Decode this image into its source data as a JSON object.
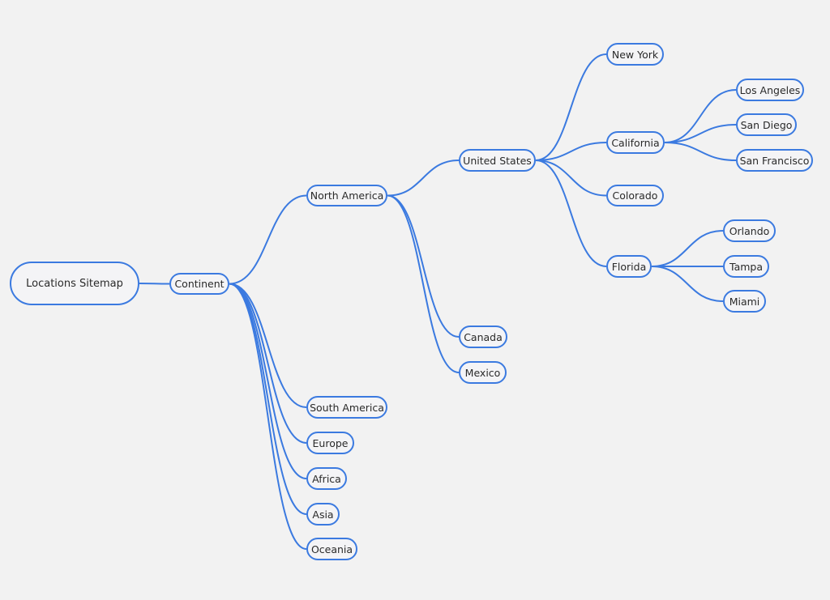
{
  "diagram": {
    "title": "Locations Sitemap",
    "edge_color": "#3b7ae0",
    "background": "#f2f2f2",
    "nodes": {
      "root": "Locations Sitemap",
      "continent": "Continent",
      "north_america": "North America",
      "south_america": "South America",
      "europe": "Europe",
      "africa": "Africa",
      "asia": "Asia",
      "oceania": "Oceania",
      "united_states": "United States",
      "canada": "Canada",
      "mexico": "Mexico",
      "new_york": "New York",
      "california": "California",
      "colorado": "Colorado",
      "florida": "Florida",
      "los_angeles": "Los Angeles",
      "san_diego": "San Diego",
      "san_francisco": "San Francisco",
      "orlando": "Orlando",
      "tampa": "Tampa",
      "miami": "Miami"
    },
    "edges": [
      [
        "root",
        "continent"
      ],
      [
        "continent",
        "north_america"
      ],
      [
        "continent",
        "south_america"
      ],
      [
        "continent",
        "europe"
      ],
      [
        "continent",
        "africa"
      ],
      [
        "continent",
        "asia"
      ],
      [
        "continent",
        "oceania"
      ],
      [
        "north_america",
        "united_states"
      ],
      [
        "north_america",
        "canada"
      ],
      [
        "north_america",
        "mexico"
      ],
      [
        "united_states",
        "new_york"
      ],
      [
        "united_states",
        "california"
      ],
      [
        "united_states",
        "colorado"
      ],
      [
        "united_states",
        "florida"
      ],
      [
        "california",
        "los_angeles"
      ],
      [
        "california",
        "san_diego"
      ],
      [
        "california",
        "san_francisco"
      ],
      [
        "florida",
        "orlando"
      ],
      [
        "florida",
        "tampa"
      ],
      [
        "florida",
        "miami"
      ]
    ]
  }
}
